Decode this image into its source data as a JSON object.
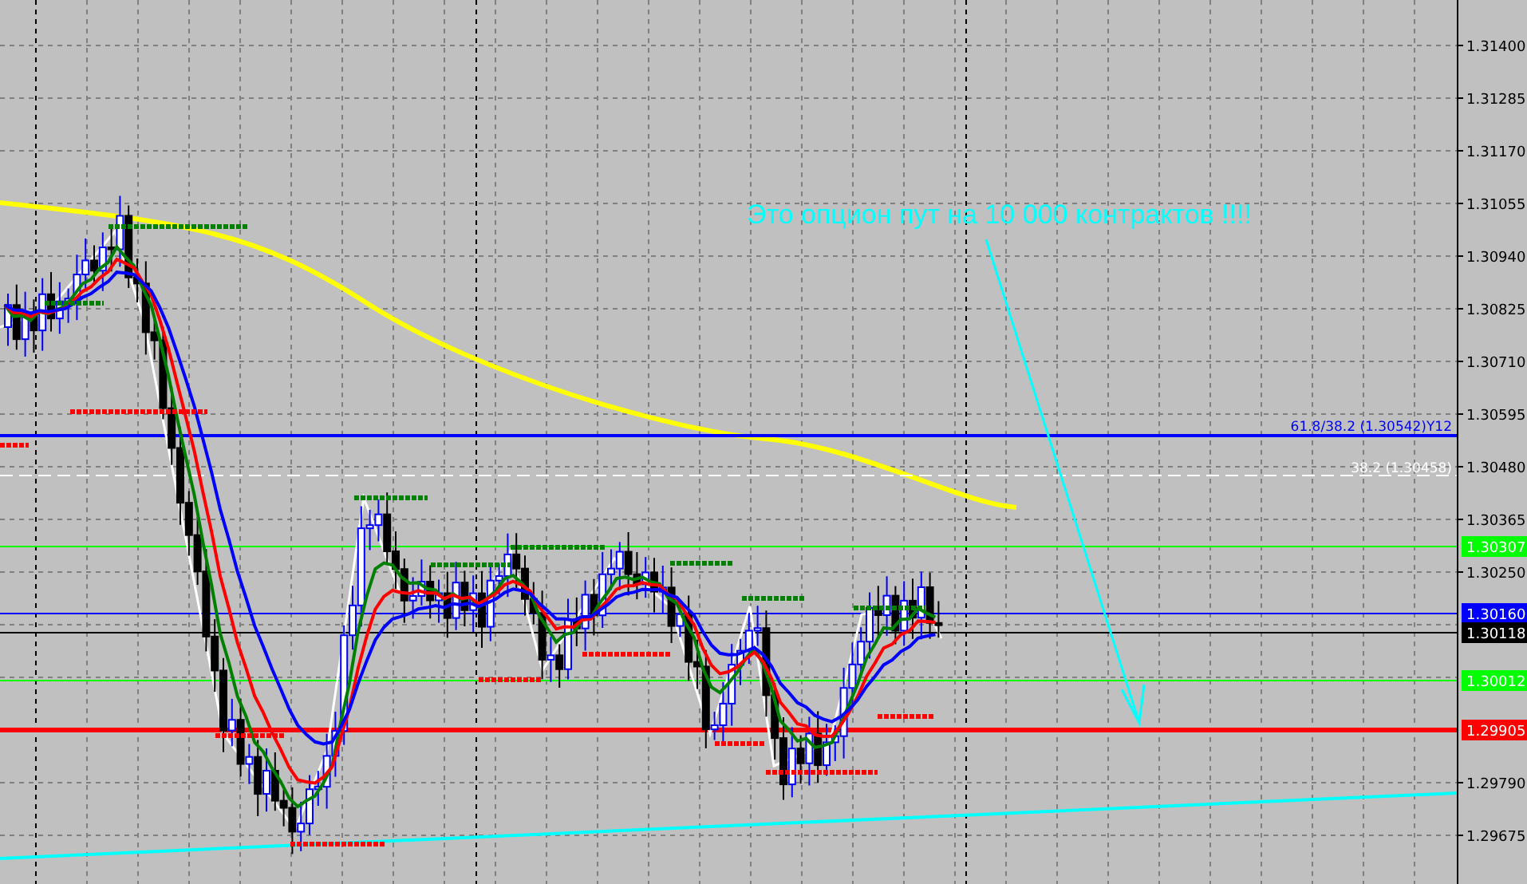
{
  "annotation": {
    "text": "Это опцион пут на 10 000 контрактов !!!!"
  },
  "fib_levels": [
    {
      "label": "61.8/38.2 (1.30542)Y12",
      "color": "#0000ff"
    },
    {
      "label": "38.2 (1.30458)",
      "color": "#ffffff"
    }
  ],
  "price_lines": [
    {
      "label": "1.30307",
      "color": "#00ff00"
    },
    {
      "label": "1.30160",
      "color": "#0000ff"
    },
    {
      "label": "1.30118",
      "color": "#000000"
    },
    {
      "label": "1.30012",
      "color": "#00ff00"
    },
    {
      "label": "1.29905",
      "color": "#ff0000"
    }
  ],
  "price_axis": {
    "ticks": [
      "1.31400",
      "1.31285",
      "1.31170",
      "1.31055",
      "1.30940",
      "1.30825",
      "1.30710",
      "1.30595",
      "1.30480",
      "1.30365",
      "1.30250",
      "1.29790",
      "1.29675"
    ]
  }
}
